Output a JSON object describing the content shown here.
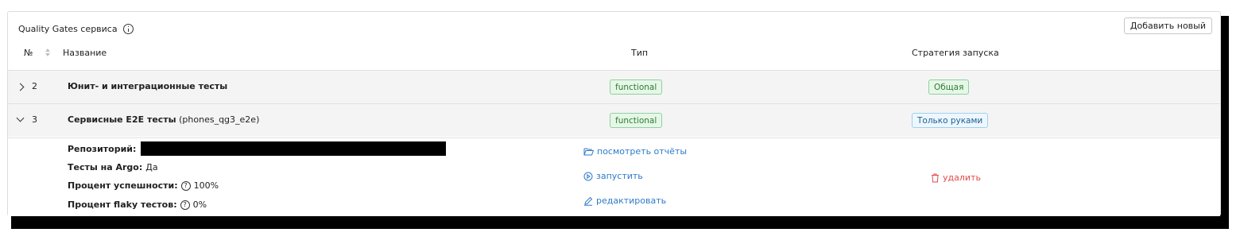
{
  "panel": {
    "title": "Quality Gates сервиса",
    "add_button": "Добавить новый"
  },
  "table": {
    "headers": {
      "number": "№",
      "name": "Название",
      "type": "Тип",
      "strategy": "Стратегия запуска"
    },
    "rows": [
      {
        "number": "2",
        "name": "Юнит- и интеграционные тесты",
        "name_suffix": "",
        "type": "functional",
        "strategy": "Общая",
        "expanded": false
      },
      {
        "number": "3",
        "name": "Сервисные E2E тесты",
        "name_suffix": "(phones_qg3_e2e)",
        "type": "functional",
        "strategy": "Только руками",
        "expanded": true
      }
    ]
  },
  "details": {
    "repo_label": "Репозиторий:",
    "argo_label": "Тесты на Argo:",
    "argo_value": "Да",
    "success_label": "Процент успешности:",
    "success_value": "100%",
    "flaky_label": "Процент flaky тестов:",
    "flaky_value": "0%",
    "help_glyph": "?",
    "actions": {
      "reports": "посмотреть отчёты",
      "run": "запустить",
      "edit": "редактировать",
      "delete": "удалить"
    }
  },
  "colors": {
    "link": "#2f7bc8",
    "danger": "#e04a4a",
    "tag_green": "#2e7d32",
    "tag_blue": "#1d5f93"
  }
}
